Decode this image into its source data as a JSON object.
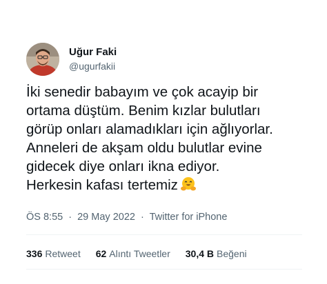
{
  "author": {
    "display_name": "Uğur Faki",
    "handle": "@ugurfakii"
  },
  "tweet": {
    "lines": [
      "İki senedir babayım ve çok acayip bir",
      "ortama düştüm. Benim kızlar bulutları",
      "görüp onları alamadıkları için ağlıyorlar.",
      "Anneleri de akşam oldu bulutlar evine",
      "gidecek diye onları ikna ediyor.",
      "Herkesin kafası tertemiz"
    ],
    "emoji": "smiling-face-with-open-hands"
  },
  "meta": {
    "time": "ÖS 8:55",
    "separator": "·",
    "date": "29 May 2022",
    "source": "Twitter for iPhone"
  },
  "stats": {
    "retweets": {
      "count": "336",
      "label": "Retweet"
    },
    "quotes": {
      "count": "62",
      "label": "Alıntı Tweetler"
    },
    "likes": {
      "count": "30,4 B",
      "label": "Beğeni"
    }
  },
  "colors": {
    "text": "#0f1419",
    "secondary": "#536471",
    "divider": "#eff3f4",
    "background": "#ffffff"
  }
}
